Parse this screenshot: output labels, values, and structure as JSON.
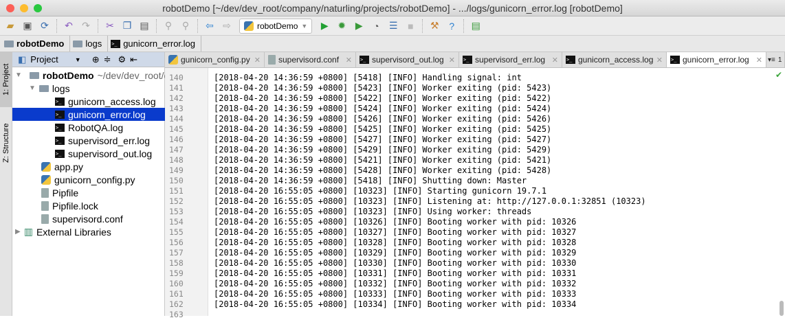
{
  "window": {
    "title": "robotDemo [~/dev/dev_root/company/naturling/projects/robotDemo] - .../logs/gunicorn_error.log [robotDemo]"
  },
  "toolbar": {
    "run_config": "robotDemo"
  },
  "breadcrumb": [
    "robotDemo",
    "logs",
    "gunicorn_error.log"
  ],
  "side_strip": {
    "project": "1: Project",
    "structure": "Z: Structure"
  },
  "project_panel": {
    "title": "Project",
    "root": {
      "name": "robotDemo",
      "path": "~/dev/dev_root/c"
    },
    "items": [
      {
        "label": "logs",
        "type": "folder",
        "depth": 1
      },
      {
        "label": "gunicorn_access.log",
        "type": "log",
        "depth": 2
      },
      {
        "label": "gunicorn_error.log",
        "type": "log",
        "depth": 2,
        "selected": true
      },
      {
        "label": "RobotQA.log",
        "type": "log",
        "depth": 2
      },
      {
        "label": "supervisord_err.log",
        "type": "log",
        "depth": 2
      },
      {
        "label": "supervisord_out.log",
        "type": "log",
        "depth": 2
      },
      {
        "label": "app.py",
        "type": "py",
        "depth": 1
      },
      {
        "label": "gunicorn_config.py",
        "type": "py",
        "depth": 1
      },
      {
        "label": "Pipfile",
        "type": "file",
        "depth": 1
      },
      {
        "label": "Pipfile.lock",
        "type": "file",
        "depth": 1
      },
      {
        "label": "supervisord.conf",
        "type": "file",
        "depth": 1
      }
    ],
    "external": "External Libraries"
  },
  "tabs": [
    {
      "label": "gunicorn_config.py",
      "type": "py"
    },
    {
      "label": "supervisord.conf",
      "type": "file"
    },
    {
      "label": "supervisord_out.log",
      "type": "log"
    },
    {
      "label": "supervisord_err.log",
      "type": "log"
    },
    {
      "label": "gunicorn_access.log",
      "type": "log"
    },
    {
      "label": "gunicorn_error.log",
      "type": "log",
      "active": true
    }
  ],
  "tab_overflow": "1",
  "lines": [
    {
      "n": "140",
      "t": "[2018-04-20 14:36:59 +0800] [5418] [INFO] Handling signal: int"
    },
    {
      "n": "141",
      "t": "[2018-04-20 14:36:59 +0800] [5423] [INFO] Worker exiting (pid: 5423)"
    },
    {
      "n": "142",
      "t": "[2018-04-20 14:36:59 +0800] [5422] [INFO] Worker exiting (pid: 5422)"
    },
    {
      "n": "143",
      "t": "[2018-04-20 14:36:59 +0800] [5424] [INFO] Worker exiting (pid: 5424)"
    },
    {
      "n": "144",
      "t": "[2018-04-20 14:36:59 +0800] [5426] [INFO] Worker exiting (pid: 5426)"
    },
    {
      "n": "145",
      "t": "[2018-04-20 14:36:59 +0800] [5425] [INFO] Worker exiting (pid: 5425)"
    },
    {
      "n": "146",
      "t": "[2018-04-20 14:36:59 +0800] [5427] [INFO] Worker exiting (pid: 5427)"
    },
    {
      "n": "147",
      "t": "[2018-04-20 14:36:59 +0800] [5429] [INFO] Worker exiting (pid: 5429)"
    },
    {
      "n": "148",
      "t": "[2018-04-20 14:36:59 +0800] [5421] [INFO] Worker exiting (pid: 5421)"
    },
    {
      "n": "149",
      "t": "[2018-04-20 14:36:59 +0800] [5428] [INFO] Worker exiting (pid: 5428)"
    },
    {
      "n": "150",
      "t": "[2018-04-20 14:36:59 +0800] [5418] [INFO] Shutting down: Master"
    },
    {
      "n": "151",
      "t": "[2018-04-20 16:55:05 +0800] [10323] [INFO] Starting gunicorn 19.7.1"
    },
    {
      "n": "152",
      "t": "[2018-04-20 16:55:05 +0800] [10323] [INFO] Listening at: http://127.0.0.1:32851 (10323)"
    },
    {
      "n": "153",
      "t": "[2018-04-20 16:55:05 +0800] [10323] [INFO] Using worker: threads"
    },
    {
      "n": "154",
      "t": "[2018-04-20 16:55:05 +0800] [10326] [INFO] Booting worker with pid: 10326"
    },
    {
      "n": "155",
      "t": "[2018-04-20 16:55:05 +0800] [10327] [INFO] Booting worker with pid: 10327"
    },
    {
      "n": "156",
      "t": "[2018-04-20 16:55:05 +0800] [10328] [INFO] Booting worker with pid: 10328"
    },
    {
      "n": "157",
      "t": "[2018-04-20 16:55:05 +0800] [10329] [INFO] Booting worker with pid: 10329"
    },
    {
      "n": "158",
      "t": "[2018-04-20 16:55:05 +0800] [10330] [INFO] Booting worker with pid: 10330"
    },
    {
      "n": "159",
      "t": "[2018-04-20 16:55:05 +0800] [10331] [INFO] Booting worker with pid: 10331"
    },
    {
      "n": "160",
      "t": "[2018-04-20 16:55:05 +0800] [10332] [INFO] Booting worker with pid: 10332"
    },
    {
      "n": "161",
      "t": "[2018-04-20 16:55:05 +0800] [10333] [INFO] Booting worker with pid: 10333"
    },
    {
      "n": "162",
      "t": "[2018-04-20 16:55:05 +0800] [10334] [INFO] Booting worker with pid: 10334"
    },
    {
      "n": "163",
      "t": ""
    }
  ]
}
